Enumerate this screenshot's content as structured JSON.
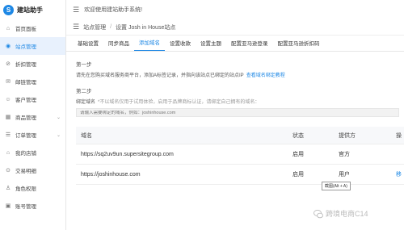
{
  "app": {
    "name": "建站助手",
    "logo_char": "S",
    "accent": "#1e88e5"
  },
  "sidebar": {
    "items": [
      {
        "label": "首页面板",
        "icon": "home-icon",
        "glyph": "⌂",
        "active": false,
        "chevron": false
      },
      {
        "label": "站点管理",
        "icon": "site-icon",
        "glyph": "◉",
        "active": true,
        "chevron": false
      },
      {
        "label": "折扣管理",
        "icon": "discount-icon",
        "glyph": "⊘",
        "active": false,
        "chevron": false
      },
      {
        "label": "邮链管理",
        "icon": "mail-link-icon",
        "glyph": "✉",
        "active": false,
        "chevron": false
      },
      {
        "label": "客户管理",
        "icon": "customer-icon",
        "glyph": "☺",
        "active": false,
        "chevron": false
      },
      {
        "label": "商品管理",
        "icon": "product-icon",
        "glyph": "▦",
        "active": false,
        "chevron": true
      },
      {
        "label": "订单管理",
        "icon": "order-icon",
        "glyph": "☰",
        "active": false,
        "chevron": true
      },
      {
        "label": "我的店铺",
        "icon": "store-icon",
        "glyph": "⌂",
        "active": false,
        "chevron": false
      },
      {
        "label": "交易明细",
        "icon": "transaction-icon",
        "glyph": "⊙",
        "active": false,
        "chevron": false
      },
      {
        "label": "角色权限",
        "icon": "role-icon",
        "glyph": "♙",
        "active": false,
        "chevron": false
      },
      {
        "label": "账号管理",
        "icon": "account-icon",
        "glyph": "▣",
        "active": false,
        "chevron": false
      }
    ],
    "chevron_glyph": "⌄"
  },
  "topbar": {
    "menu_glyph": "☰",
    "welcome": "欢迎使用建站助手系统!"
  },
  "breadcrumb": {
    "items": [
      "站点管理",
      "设置 Josh in House站点"
    ],
    "separator": "/",
    "menu_glyph": "☰"
  },
  "tabs": [
    {
      "label": "基础设置",
      "active": false
    },
    {
      "label": "同步商品",
      "active": false
    },
    {
      "label": "添加域名",
      "active": true
    },
    {
      "label": "设置收款",
      "active": false
    },
    {
      "label": "设置主题",
      "active": false
    },
    {
      "label": "配置亚马逊登录",
      "active": false
    },
    {
      "label": "配置亚马逊折扣码",
      "active": false
    }
  ],
  "step1": {
    "title": "第一步",
    "desc": "请先在您购买域名服务商平台，添加A标签记录，并指向该站点已绑定的站点IP",
    "link": "查看域名绑定教程"
  },
  "step2": {
    "title": "第二步",
    "field_label": "绑定域名",
    "hint": "*不以域名仅用于试用体验，启用于品牌商标认证，请绑定自己拥有的域名：",
    "placeholder": "请输入需要绑定的域名，例如：joshinhouse.com"
  },
  "table": {
    "headers": {
      "domain": "域名",
      "status": "状态",
      "provider": "提供方",
      "action": "操"
    },
    "rows": [
      {
        "domain": "https://sq2uv9un.supersitegroup.com",
        "status": "启用",
        "provider": "官方",
        "action": ""
      },
      {
        "domain": "https://joshinhouse.com",
        "status": "启用",
        "provider": "用户",
        "action": "移"
      }
    ]
  },
  "tooltip": "截图(Alt + A)",
  "watermark": {
    "text": "跨境电商C14"
  }
}
